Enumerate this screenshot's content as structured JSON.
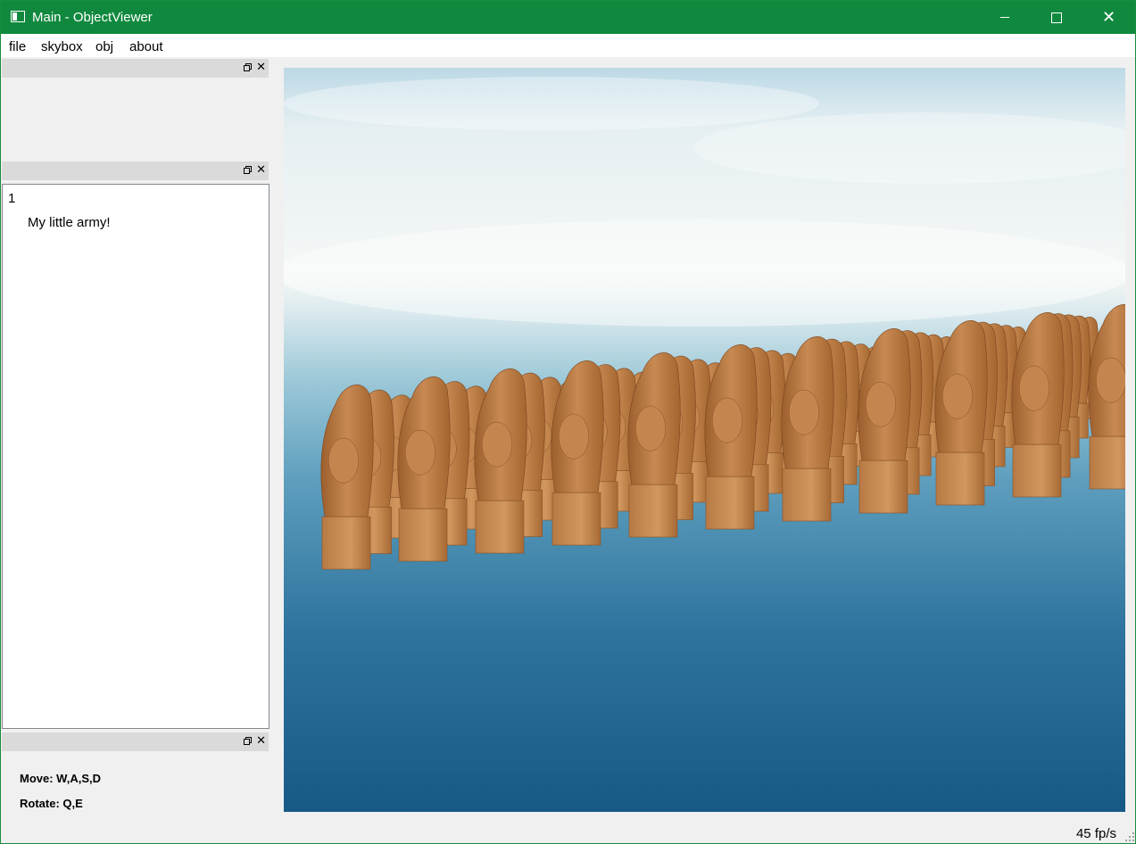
{
  "window": {
    "title": "Main - ObjectViewer",
    "accent_color": "#10893e",
    "controls": [
      "minimize-icon",
      "maximize-icon",
      "close-icon"
    ]
  },
  "menu": [
    "file",
    "skybox",
    "obj",
    "about"
  ],
  "dock_icons": [
    "float-icon",
    "close-icon"
  ],
  "tree": {
    "column": "1",
    "items": [
      "My little army!"
    ]
  },
  "help": {
    "move": "Move: W,A,S,D",
    "rotate": "Rotate: Q,E"
  },
  "status": {
    "fps": "45 fp/s"
  },
  "scene": {
    "description_colors": {
      "sky_top": "#c8e1ec",
      "horizon": "#f4f7f6",
      "sea": "#1e5f8a",
      "wood": "#b8763f"
    },
    "statue_rows": [
      [
        0,
        1,
        2,
        3,
        4,
        5,
        6,
        7,
        8,
        9,
        10
      ],
      [
        0,
        1,
        2,
        3,
        4,
        5,
        6,
        7,
        8,
        9,
        10
      ],
      [
        0,
        1,
        2,
        3,
        4,
        5,
        6,
        7,
        8,
        9,
        10
      ],
      [
        0,
        1,
        2,
        3,
        4,
        5,
        6,
        7,
        8,
        9,
        10
      ],
      [
        0,
        1,
        2,
        3,
        4,
        5,
        6,
        7,
        8,
        9,
        10
      ]
    ]
  }
}
